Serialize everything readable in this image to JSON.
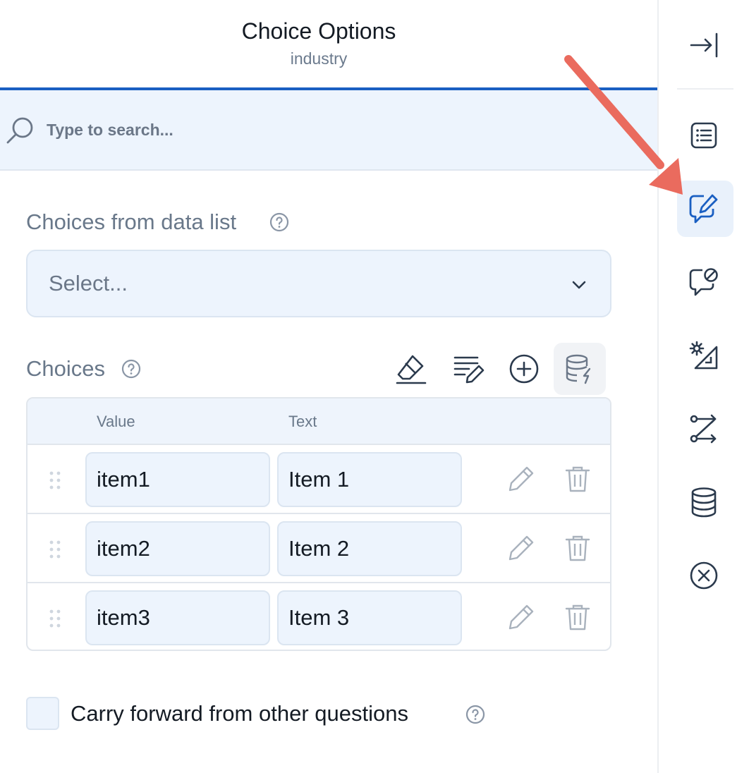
{
  "header": {
    "title": "Choice Options",
    "subtitle": "industry"
  },
  "search": {
    "placeholder": "Type to search..."
  },
  "data_list": {
    "label": "Choices from data list",
    "select_value": "Select..."
  },
  "choices": {
    "label": "Choices",
    "toolbar": [
      "eraser-icon",
      "edit-list-icon",
      "add-circle-icon",
      "database-flash-icon"
    ],
    "columns": {
      "value": "Value",
      "text": "Text"
    },
    "rows": [
      {
        "value": "item1",
        "text": "Item 1"
      },
      {
        "value": "item2",
        "text": "Item 2"
      },
      {
        "value": "item3",
        "text": "Item 3"
      }
    ]
  },
  "carry_forward": {
    "label": "Carry forward from other questions",
    "checked": false
  },
  "sidebar": {
    "icons": [
      "collapse-panel-icon",
      "list-icon",
      "edit-message-icon",
      "message-blocked-icon",
      "settings-triangle-icon",
      "logic-flow-icon",
      "database-icon",
      "close-circle-icon"
    ],
    "active": "edit-message-icon"
  },
  "colors": {
    "accent": "#1a5fc2",
    "field_bg": "#edf4fd",
    "annotation_arrow": "#ea6b5e"
  }
}
